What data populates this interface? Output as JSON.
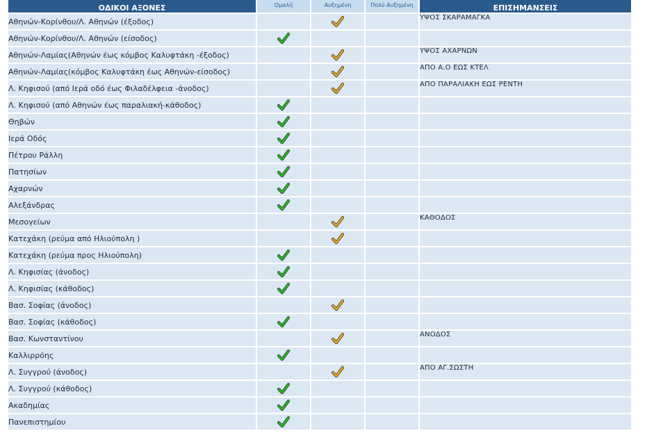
{
  "table": {
    "headers": {
      "road_axes": "ΟΔΙΚΟΙ ΑΞΟΝΕΣ",
      "normal": "Ομαλή",
      "increased": "Αυξημένη",
      "very_increased": "Πολύ Αυξημένη",
      "notes": "ΕΠΙΣΗΜΑΝΣΕΙΣ"
    },
    "colors": {
      "header_bg": "#2a5a8c",
      "row_bg": "#dbe7f2",
      "check_normal": "#22bb22",
      "check_increased": "#f0a818"
    },
    "rows": [
      {
        "road": "Αθηνών-Κορίνθου/Λ. Αθηνών (έξοδος)",
        "traffic": "increased",
        "note": "ΥΨΟΣ ΣΚΑΡΑΜΑΓΚΑ"
      },
      {
        "road": "Αθηνών-Κορίνθου/Λ. Αθηνών (είσοδος)",
        "traffic": "normal",
        "note": ""
      },
      {
        "road": "Αθηνών-Λαμίας(Αθηνών έως κόμβος Καλυφτάκη -έξοδος)",
        "traffic": "increased",
        "note": "ΥΨΟΣ ΑΧΑΡΝΩΝ"
      },
      {
        "road": "Αθηνών-Λαμίας(κόμβος Καλυφτάκη έως Αθηνών-είσοδος)",
        "traffic": "increased",
        "note": "ΑΠΟ Α.Ο ΕΩΣ ΚΤΕΛ"
      },
      {
        "road": "Λ. Κηφισού (από Ιερά οδό έως Φιλαδέλφεια -άνοδος)",
        "traffic": "increased",
        "note": "ΑΠΟ ΠΑΡΑΛΙΑΚΗ ΕΩΣ ΡΕΝΤΗ"
      },
      {
        "road": "Λ. Κηφισού (από Αθηνών έως παραλιακή-κάθοδος)",
        "traffic": "normal",
        "note": ""
      },
      {
        "road": "Θηβών",
        "traffic": "normal",
        "note": ""
      },
      {
        "road": "Ιερά Οδός",
        "traffic": "normal",
        "note": ""
      },
      {
        "road": "Πέτρου Ράλλη",
        "traffic": "normal",
        "note": ""
      },
      {
        "road": "Πατησίων",
        "traffic": "normal",
        "note": ""
      },
      {
        "road": "Αχαρνών",
        "traffic": "normal",
        "note": ""
      },
      {
        "road": "Αλεξάνδρας",
        "traffic": "normal",
        "note": ""
      },
      {
        "road": "Μεσογείων",
        "traffic": "increased",
        "note": "ΚΑΘΟΔΟΣ"
      },
      {
        "road": "Κατεχάκη (ρεύμα από Ηλιούπολη )",
        "traffic": "increased",
        "note": ""
      },
      {
        "road": "Κατεχάκη (ρεύμα προς Ηλιούπολη)",
        "traffic": "normal",
        "note": ""
      },
      {
        "road": "Λ. Κηφισίας (άνοδος)",
        "traffic": "normal",
        "note": ""
      },
      {
        "road": "Λ. Κηφισίας (κάθοδος)",
        "traffic": "normal",
        "note": ""
      },
      {
        "road": "Βασ. Σοφίας (άνοδος)",
        "traffic": "increased",
        "note": ""
      },
      {
        "road": "Βασ. Σοφίας (κάθοδος)",
        "traffic": "normal",
        "note": ""
      },
      {
        "road": "Βασ. Κωνσταντίνου",
        "traffic": "increased",
        "note": "ΑΝΟΔΟΣ"
      },
      {
        "road": "Καλλιρρόης",
        "traffic": "normal",
        "note": ""
      },
      {
        "road": "Λ. Συγγρού (άνοδος)",
        "traffic": "increased",
        "note": "ΑΠΟ ΑΓ.ΣΩΣΤΗ"
      },
      {
        "road": "Λ. Συγγρού (κάθοδος)",
        "traffic": "normal",
        "note": ""
      },
      {
        "road": "Ακαδημίας",
        "traffic": "normal",
        "note": ""
      },
      {
        "road": "Πανεπιστημίου",
        "traffic": "normal",
        "note": ""
      }
    ]
  }
}
